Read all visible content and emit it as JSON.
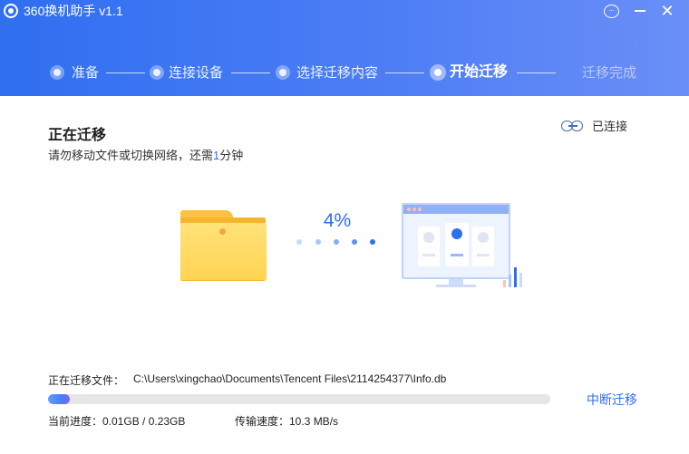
{
  "app": {
    "title": "360换机助手 v1.1",
    "accent_color": "#2f6ff0",
    "icons": [
      "app-logo-icon",
      "feedback-icon",
      "minimize-icon",
      "close-icon"
    ]
  },
  "steps": [
    {
      "label": "准备",
      "state": "done"
    },
    {
      "label": "连接设备",
      "state": "done"
    },
    {
      "label": "选择迁移内容",
      "state": "done"
    },
    {
      "label": "开始迁移",
      "state": "active"
    },
    {
      "label": "迁移完成",
      "state": "pending"
    }
  ],
  "migration": {
    "title": "正在迁移",
    "notice_prefix": "请勿移动文件或切换网络，还需",
    "notice_number": "1",
    "notice_suffix": "分钟",
    "connection_status": "已连接",
    "percent_text": "4%",
    "progress_fraction": 0.04,
    "current_file_label": "正在迁移文件：",
    "current_file_path": "C:\\Users\\xingchao\\Documents\\Tencent Files\\2114254377\\Info.db",
    "progress_text": "当前进度：0.01GB / 0.23GB",
    "speed_text": "传输速度：10.3 MB/s",
    "stop_button": "中断迁移"
  }
}
